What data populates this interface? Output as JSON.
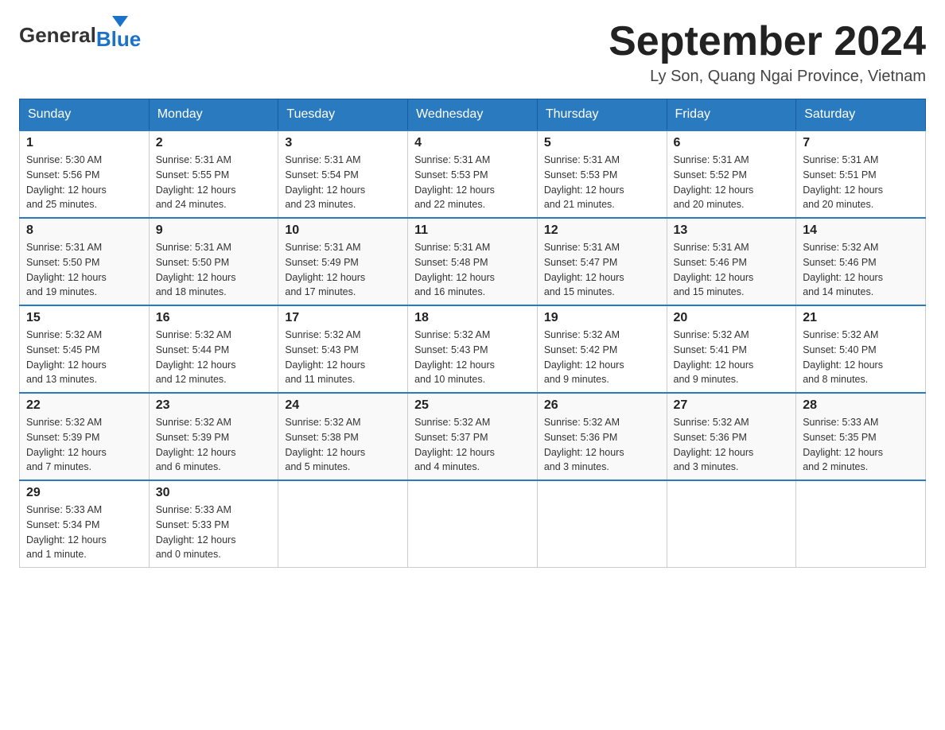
{
  "header": {
    "logo_general": "General",
    "logo_blue": "Blue",
    "month_title": "September 2024",
    "location": "Ly Son, Quang Ngai Province, Vietnam"
  },
  "weekdays": [
    "Sunday",
    "Monday",
    "Tuesday",
    "Wednesday",
    "Thursday",
    "Friday",
    "Saturday"
  ],
  "weeks": [
    [
      {
        "day": "1",
        "sunrise": "5:30 AM",
        "sunset": "5:56 PM",
        "daylight": "12 hours and 25 minutes."
      },
      {
        "day": "2",
        "sunrise": "5:31 AM",
        "sunset": "5:55 PM",
        "daylight": "12 hours and 24 minutes."
      },
      {
        "day": "3",
        "sunrise": "5:31 AM",
        "sunset": "5:54 PM",
        "daylight": "12 hours and 23 minutes."
      },
      {
        "day": "4",
        "sunrise": "5:31 AM",
        "sunset": "5:53 PM",
        "daylight": "12 hours and 22 minutes."
      },
      {
        "day": "5",
        "sunrise": "5:31 AM",
        "sunset": "5:53 PM",
        "daylight": "12 hours and 21 minutes."
      },
      {
        "day": "6",
        "sunrise": "5:31 AM",
        "sunset": "5:52 PM",
        "daylight": "12 hours and 20 minutes."
      },
      {
        "day": "7",
        "sunrise": "5:31 AM",
        "sunset": "5:51 PM",
        "daylight": "12 hours and 20 minutes."
      }
    ],
    [
      {
        "day": "8",
        "sunrise": "5:31 AM",
        "sunset": "5:50 PM",
        "daylight": "12 hours and 19 minutes."
      },
      {
        "day": "9",
        "sunrise": "5:31 AM",
        "sunset": "5:50 PM",
        "daylight": "12 hours and 18 minutes."
      },
      {
        "day": "10",
        "sunrise": "5:31 AM",
        "sunset": "5:49 PM",
        "daylight": "12 hours and 17 minutes."
      },
      {
        "day": "11",
        "sunrise": "5:31 AM",
        "sunset": "5:48 PM",
        "daylight": "12 hours and 16 minutes."
      },
      {
        "day": "12",
        "sunrise": "5:31 AM",
        "sunset": "5:47 PM",
        "daylight": "12 hours and 15 minutes."
      },
      {
        "day": "13",
        "sunrise": "5:31 AM",
        "sunset": "5:46 PM",
        "daylight": "12 hours and 15 minutes."
      },
      {
        "day": "14",
        "sunrise": "5:32 AM",
        "sunset": "5:46 PM",
        "daylight": "12 hours and 14 minutes."
      }
    ],
    [
      {
        "day": "15",
        "sunrise": "5:32 AM",
        "sunset": "5:45 PM",
        "daylight": "12 hours and 13 minutes."
      },
      {
        "day": "16",
        "sunrise": "5:32 AM",
        "sunset": "5:44 PM",
        "daylight": "12 hours and 12 minutes."
      },
      {
        "day": "17",
        "sunrise": "5:32 AM",
        "sunset": "5:43 PM",
        "daylight": "12 hours and 11 minutes."
      },
      {
        "day": "18",
        "sunrise": "5:32 AM",
        "sunset": "5:43 PM",
        "daylight": "12 hours and 10 minutes."
      },
      {
        "day": "19",
        "sunrise": "5:32 AM",
        "sunset": "5:42 PM",
        "daylight": "12 hours and 9 minutes."
      },
      {
        "day": "20",
        "sunrise": "5:32 AM",
        "sunset": "5:41 PM",
        "daylight": "12 hours and 9 minutes."
      },
      {
        "day": "21",
        "sunrise": "5:32 AM",
        "sunset": "5:40 PM",
        "daylight": "12 hours and 8 minutes."
      }
    ],
    [
      {
        "day": "22",
        "sunrise": "5:32 AM",
        "sunset": "5:39 PM",
        "daylight": "12 hours and 7 minutes."
      },
      {
        "day": "23",
        "sunrise": "5:32 AM",
        "sunset": "5:39 PM",
        "daylight": "12 hours and 6 minutes."
      },
      {
        "day": "24",
        "sunrise": "5:32 AM",
        "sunset": "5:38 PM",
        "daylight": "12 hours and 5 minutes."
      },
      {
        "day": "25",
        "sunrise": "5:32 AM",
        "sunset": "5:37 PM",
        "daylight": "12 hours and 4 minutes."
      },
      {
        "day": "26",
        "sunrise": "5:32 AM",
        "sunset": "5:36 PM",
        "daylight": "12 hours and 3 minutes."
      },
      {
        "day": "27",
        "sunrise": "5:32 AM",
        "sunset": "5:36 PM",
        "daylight": "12 hours and 3 minutes."
      },
      {
        "day": "28",
        "sunrise": "5:33 AM",
        "sunset": "5:35 PM",
        "daylight": "12 hours and 2 minutes."
      }
    ],
    [
      {
        "day": "29",
        "sunrise": "5:33 AM",
        "sunset": "5:34 PM",
        "daylight": "12 hours and 1 minute."
      },
      {
        "day": "30",
        "sunrise": "5:33 AM",
        "sunset": "5:33 PM",
        "daylight": "12 hours and 0 minutes."
      },
      null,
      null,
      null,
      null,
      null
    ]
  ],
  "labels": {
    "sunrise_prefix": "Sunrise: ",
    "sunset_prefix": "Sunset: ",
    "daylight_prefix": "Daylight: "
  }
}
